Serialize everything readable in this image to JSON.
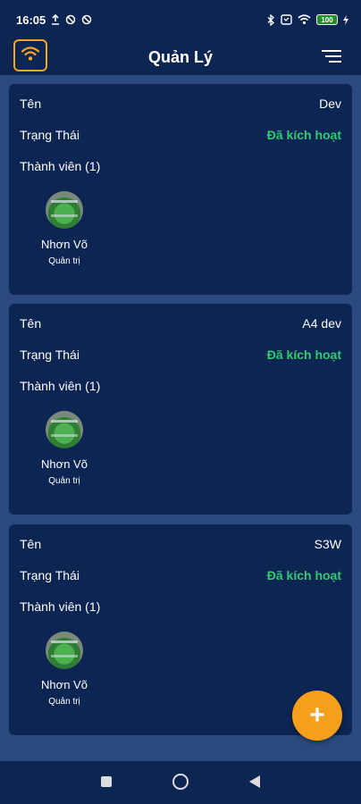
{
  "status_bar": {
    "time": "16:05",
    "battery": "100"
  },
  "app_bar": {
    "title": "Quản Lý"
  },
  "cards": [
    {
      "name_label": "Tên",
      "name_value": "Dev",
      "status_label": "Trạng Thái",
      "status_value": "Đã kích hoạt",
      "members_label": "Thành viên (1)",
      "member": {
        "name": "Nhơn Võ",
        "role": "Quản trị"
      }
    },
    {
      "name_label": "Tên",
      "name_value": "A4 dev",
      "status_label": "Trạng Thái",
      "status_value": "Đã kích hoạt",
      "members_label": "Thành viên (1)",
      "member": {
        "name": "Nhơn Võ",
        "role": "Quản trị"
      }
    },
    {
      "name_label": "Tên",
      "name_value": "S3W",
      "status_label": "Trạng Thái",
      "status_value": "Đã kích hoạt",
      "members_label": "Thành viên (1)",
      "member": {
        "name": "Nhơn Võ",
        "role": "Quản trị"
      }
    }
  ],
  "fab": {
    "label": "+"
  },
  "colors": {
    "background": "#2a4a7f",
    "card": "#0d2553",
    "accent": "#f59f1c",
    "active_status": "#2ecc71"
  }
}
